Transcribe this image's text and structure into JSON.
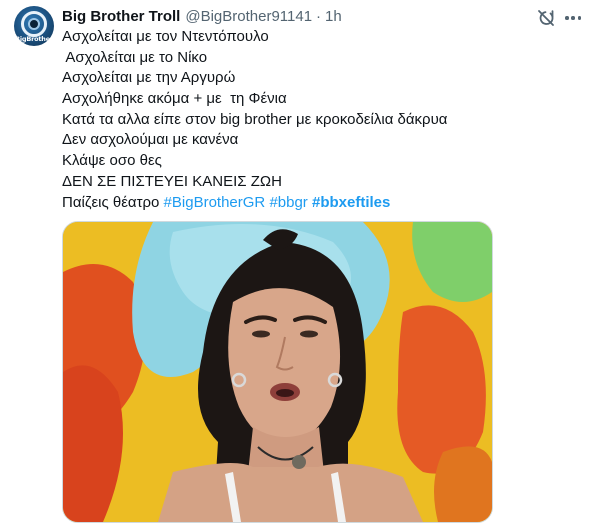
{
  "author": {
    "display_name": "Big Brother Troll",
    "handle": "@BigBrother91141",
    "separator": "·",
    "time": "1h",
    "avatar_label": "BigBrother"
  },
  "tweet": {
    "lines": [
      "Ασχολείται με τον Ντεντόπουλο",
      " Ασχολείται με το Νίκο",
      "Ασχολείται με την Αργυρώ",
      "Ασχολήθηκε ακόμα + με  τη Φένια",
      "Κατά τα αλλα είπε στον big brother με κροκοδείλια δάκρυα",
      "Δεν ασχολούμαι με κανένα",
      "Κλάψε οσο θες",
      "ΔΕΝ ΣΕ ΠΙΣΤΕΥΕΙ ΚΑΝΕΙΣ ΖΩΗ"
    ],
    "last_line_prefix": "Παίζεις θέατρο ",
    "hashtags": [
      "#BigBrotherGR",
      "#bbgr",
      "#bbxeftiles"
    ]
  },
  "icons": {
    "grok": "grok-icon",
    "more": "more-icon"
  },
  "colors": {
    "link": "#1d9bf0",
    "secondary_text": "#536471",
    "primary_text": "#0f1419"
  }
}
